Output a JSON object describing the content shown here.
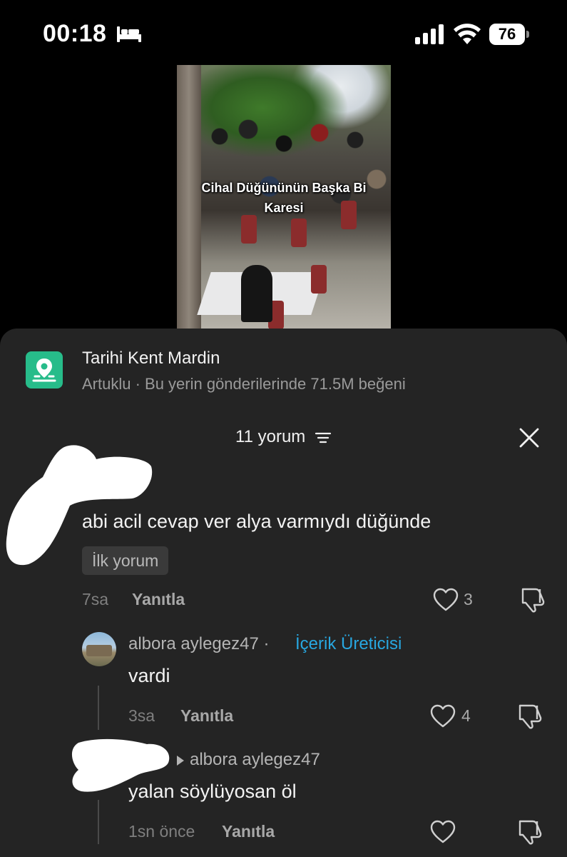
{
  "status_bar": {
    "time": "00:18",
    "battery": "76",
    "icons": [
      "bed-icon",
      "signal-icon",
      "wifi-icon",
      "battery-icon"
    ]
  },
  "video": {
    "caption_line1": "Cihal Düğününün Başka Bi",
    "caption_line2": "Karesi"
  },
  "location": {
    "title": "Tarihi Kent Mardin",
    "subtitle": "Artuklu · Bu yerin gönderilerinde 71.5M beğeni",
    "icon": "location-pin-icon",
    "icon_color": "#27bc8a"
  },
  "comments_header": {
    "count_label": "11 yorum",
    "sort_icon": "sort-icon",
    "close_icon": "close-icon"
  },
  "comments": [
    {
      "text": "abi acil cevap ver alya varmıydı düğünde",
      "badge": "İlk yorum",
      "time": "7sa",
      "reply_label": "Yanıtla",
      "likes": "3"
    }
  ],
  "replies": [
    {
      "username": "albora aylegez47",
      "separator": "·",
      "tag": "İçerik Üreticisi",
      "text": "vardi",
      "time": "3sa",
      "reply_label": "Yanıtla",
      "likes": "4"
    },
    {
      "reply_to": "albora aylegez47",
      "text": "yalan söylüyosan öl",
      "time": "1sn önce",
      "reply_label": "Yanıtla",
      "likes": ""
    }
  ],
  "colors": {
    "sheet_bg": "#242424",
    "accent_blue": "#28a7e0",
    "location_green": "#27bc8a"
  }
}
